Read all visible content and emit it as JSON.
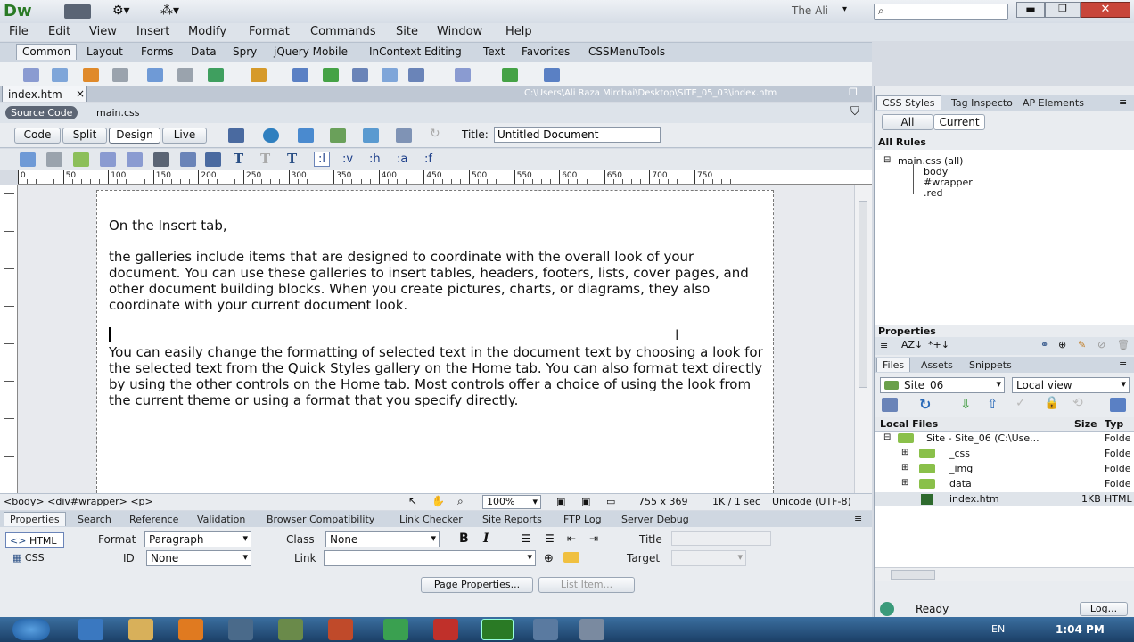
{
  "app": {
    "logo": "Dw",
    "user": "The Ali",
    "search_placeholder": ""
  },
  "menu": [
    "File",
    "Edit",
    "View",
    "Insert",
    "Modify",
    "Format",
    "Commands",
    "Site",
    "Window",
    "Help"
  ],
  "insert_tabs": [
    "Common",
    "Layout",
    "Forms",
    "Data",
    "Spry",
    "jQuery Mobile",
    "InContext Editing",
    "Text",
    "Favorites",
    "CSSMenuTools"
  ],
  "doc": {
    "tab": "index.htm",
    "close": "×",
    "path": "C:\\Users\\Ali Raza Mirchai\\Desktop\\SITE_05_03\\index.htm",
    "source_code": "Source Code",
    "related_file": "main.css"
  },
  "views": {
    "code": "Code",
    "split": "Split",
    "design": "Design",
    "live": "Live",
    "title_label": "Title:",
    "title_value": "Untitled Document"
  },
  "format_buttons": [
    ":l",
    ":v",
    ":h",
    ":a",
    ":f"
  ],
  "ruler_labels": [
    "0",
    "50",
    "100",
    "150",
    "200",
    "250",
    "300",
    "350",
    "400",
    "450",
    "500",
    "550",
    "600",
    "650",
    "700",
    "750"
  ],
  "page": {
    "p1": "On the Insert tab,",
    "p2": "the galleries include items that are designed to coordinate with the overall look of your document. You can use these galleries to insert tables, headers, footers, lists, cover pages, and other document building blocks. When you create pictures, charts, or diagrams, they also coordinate with your current document look.",
    "p3": "You can easily change the formatting of selected text in the document text by choosing a look for the selected text from the Quick Styles gallery on the Home tab. You can also format text directly by using the other controls on the Home tab. Most controls offer a choice of using the look from the current theme or using a format that you specify directly."
  },
  "status": {
    "tags": "<body> <div#wrapper> <p>",
    "zoom": "100%",
    "size": "755 x 369",
    "speed": "1K / 1 sec",
    "encoding": "Unicode (UTF-8)"
  },
  "panel_tabs": [
    "Properties",
    "Search",
    "Reference",
    "Validation",
    "Browser Compatibility",
    "Link Checker",
    "Site Reports",
    "FTP Log",
    "Server Debug"
  ],
  "properties": {
    "html": "HTML",
    "css": "CSS",
    "format_label": "Format",
    "format_value": "Paragraph",
    "class_label": "Class",
    "class_value": "None",
    "id_label": "ID",
    "id_value": "None",
    "link_label": "Link",
    "title_label": "Title",
    "target_label": "Target",
    "bold": "B",
    "italic": "I",
    "page_props": "Page Properties...",
    "list_item": "List Item..."
  },
  "css_panel": {
    "tabs": [
      "CSS Styles",
      "Tag Inspecto",
      "AP Elements"
    ],
    "all": "All",
    "current": "Current",
    "all_rules": "All Rules",
    "sheet": "main.css (all)",
    "rules": [
      "body",
      "#wrapper",
      ".red"
    ],
    "properties": "Properties"
  },
  "files_panel": {
    "tabs": [
      "Files",
      "Assets",
      "Snippets"
    ],
    "site": "Site_06",
    "view": "Local view",
    "col_local": "Local Files",
    "col_size": "Size",
    "col_type": "Typ",
    "rows": [
      {
        "name": "Site - Site_06 (C:\\Use...",
        "size": "",
        "type": "Folde"
      },
      {
        "name": "_css",
        "size": "",
        "type": "Folde"
      },
      {
        "name": "_img",
        "size": "",
        "type": "Folde"
      },
      {
        "name": "data",
        "size": "",
        "type": "Folde"
      },
      {
        "name": "index.htm",
        "size": "1KB",
        "type": "HTML"
      }
    ],
    "status": "Ready",
    "log": "Log..."
  },
  "taskbar": {
    "lang": "EN",
    "time": "1:04 PM"
  }
}
